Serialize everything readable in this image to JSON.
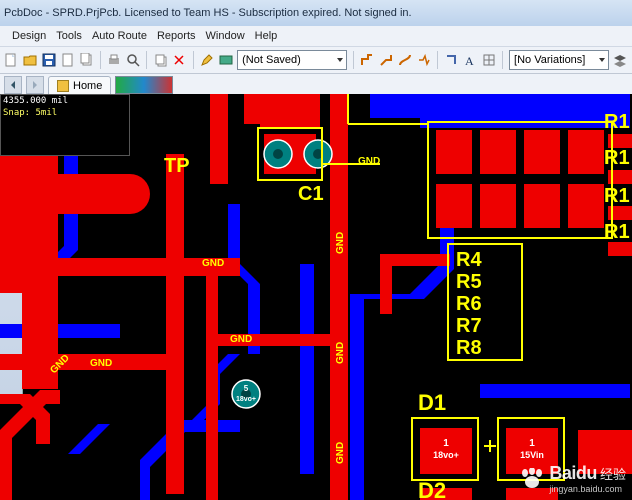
{
  "title": "PcbDoc - SPRD.PrjPcb. Licensed to Team HS - Subscription expired. Not signed in.",
  "menu": {
    "items": [
      "Design",
      "Tools",
      "Auto Route",
      "Reports",
      "Window",
      "Help"
    ]
  },
  "toolbar": {
    "save_state_label": "(Not Saved)",
    "variations_label": "[No Variations]"
  },
  "tabstrip": {
    "home_label": "Home"
  },
  "status_overlay": {
    "coord": "4355.000 mil",
    "snap": "Snap: 5mil"
  },
  "designators": {
    "tp": "TP",
    "c1": "C1",
    "r4": "R4",
    "r5": "R5",
    "r6": "R6",
    "r7": "R7",
    "r8": "R8",
    "d1": "D1",
    "d2": "D2",
    "r11": "R1",
    "r12": "R1",
    "r13": "R1",
    "r14": "R1"
  },
  "nets": {
    "gnd": "GND",
    "via5_a": "5",
    "via5_b": "18vo+",
    "pad1_a": "1",
    "pad1_b": "18vo+",
    "pad2_a": "1",
    "pad2_b": "15Vin"
  },
  "watermark": {
    "brand": "Baidu",
    "kind": "经验",
    "sub": "jingyan.baidu.com"
  },
  "icons": {
    "new": "new",
    "open": "open",
    "save": "save",
    "page": "page",
    "copy": "copy",
    "paste": "paste",
    "cut": "cut",
    "pencil": "pencil",
    "variations": "variations",
    "route1": "route",
    "route2": "route",
    "route3": "route",
    "route4": "route",
    "ortho": "ortho",
    "text": "text",
    "grid": "grid",
    "layers": "layers"
  }
}
